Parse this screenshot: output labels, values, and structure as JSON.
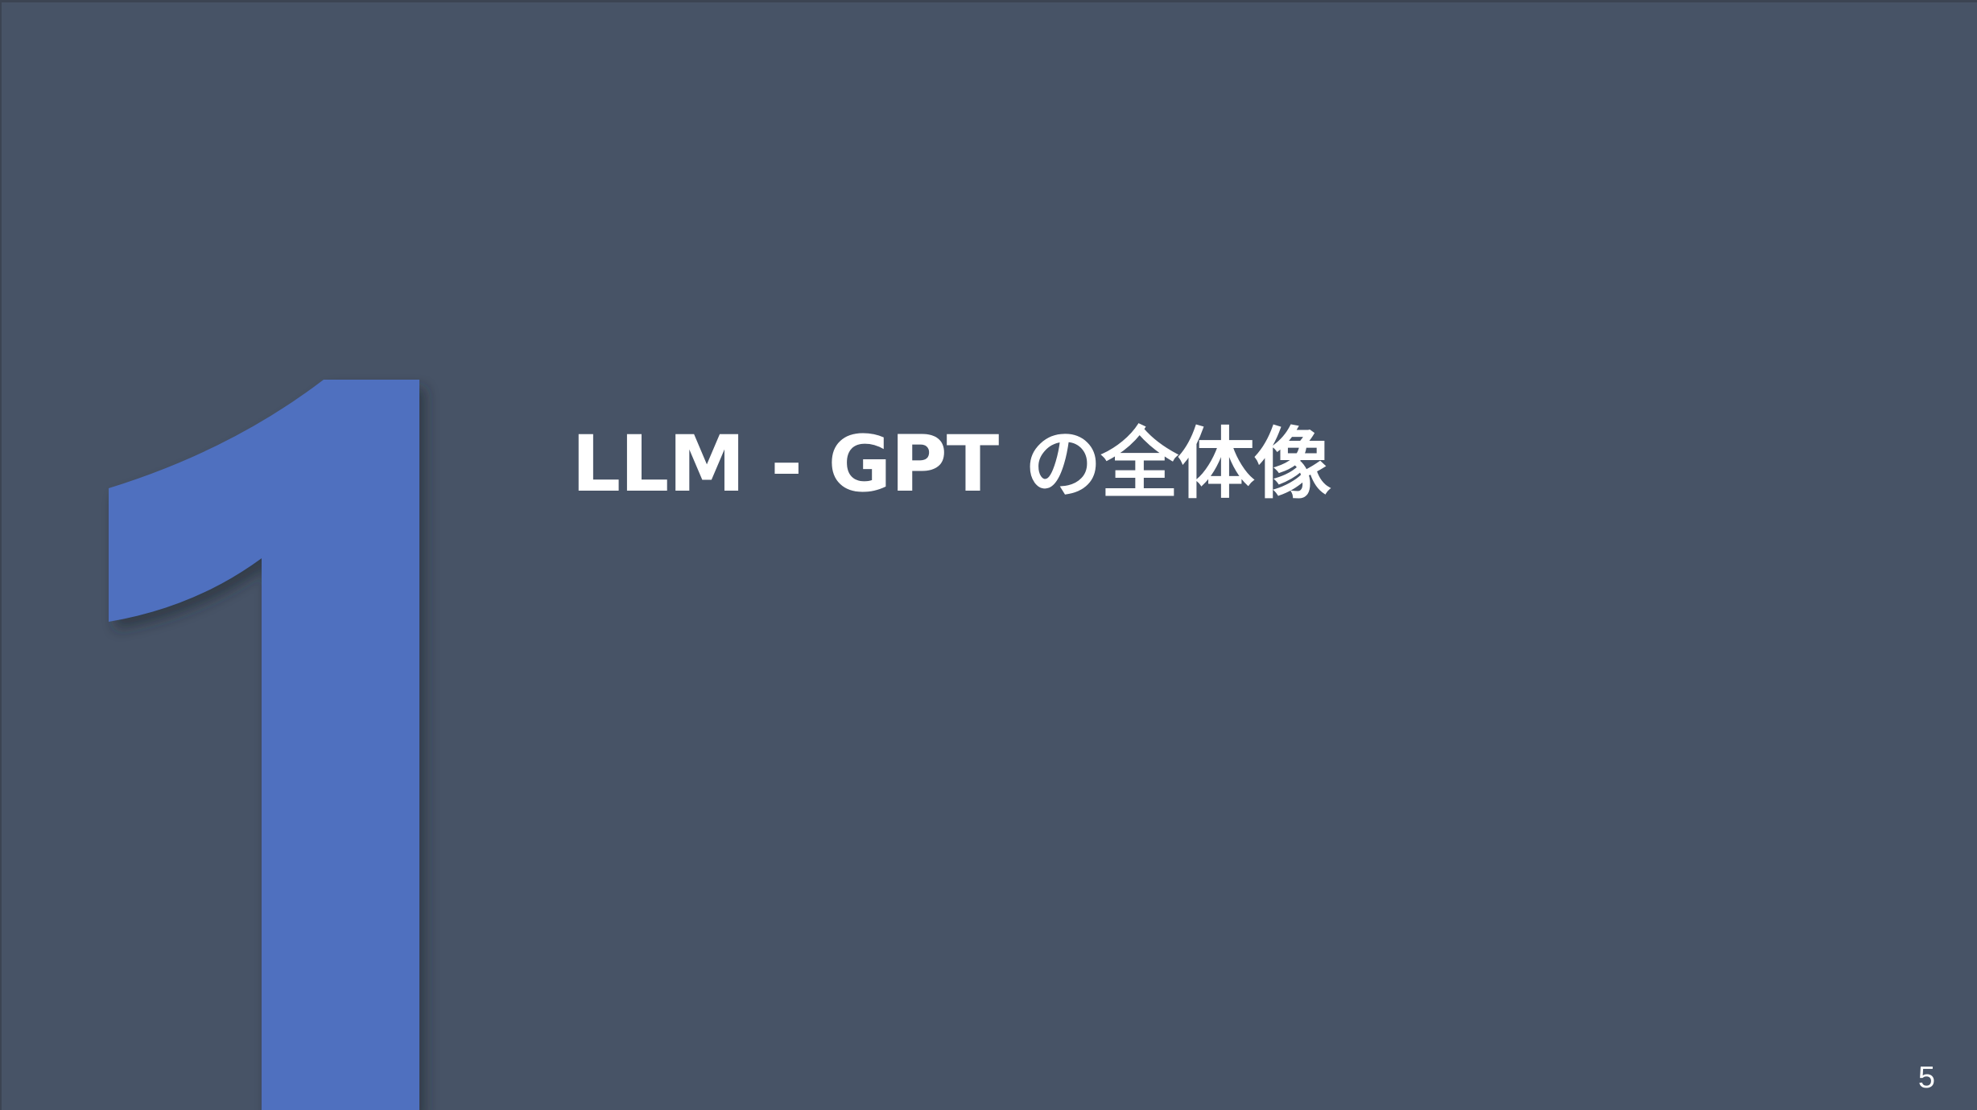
{
  "slide": {
    "title": "LLM - GPT の全体像",
    "section_number": "1",
    "page_number": "5"
  },
  "colors": {
    "background": "#475366",
    "numeral": "#5070bf",
    "text": "#ffffff"
  }
}
